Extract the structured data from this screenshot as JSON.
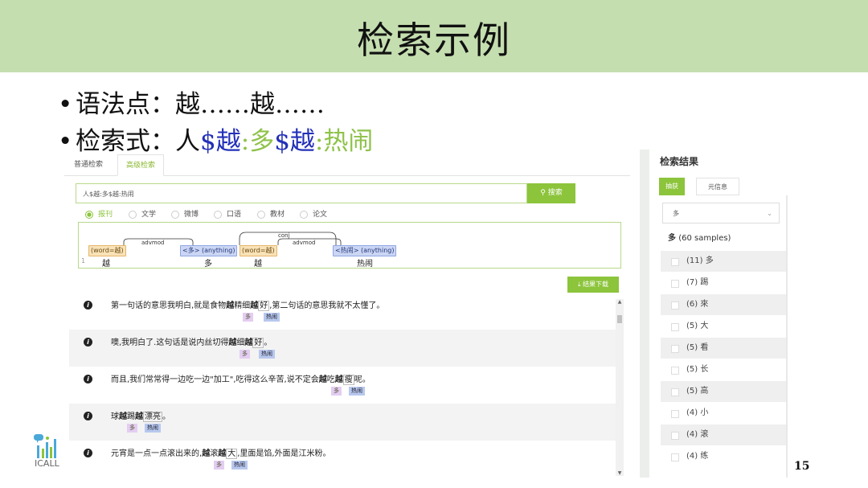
{
  "slide": {
    "title": "检索示例",
    "bullet1_label": "语法点：",
    "bullet1_value": "越……越……",
    "bullet2_label": "检索式：",
    "bullet2_parts": [
      "人",
      "$越",
      ":",
      "多",
      "$越",
      ":",
      "热闹"
    ],
    "page_number": "15",
    "logo_text": "ICALL"
  },
  "app": {
    "tabs": [
      "普通检索",
      "高级检索"
    ],
    "active_tab": "高级检索",
    "search_value": "人$越:多$越:热闹",
    "search_button": "搜索",
    "radios": [
      "报刊",
      "文学",
      "微博",
      "口语",
      "教材",
      "论文"
    ],
    "radio_selected": "报刊",
    "download_button": "结果下载"
  },
  "parse": {
    "line_number": "1",
    "nodes": [
      "(word=越)",
      "<多> (anything)",
      "(word=越)",
      "<热闹> (anything)"
    ],
    "tokens": [
      "越",
      "多",
      "越",
      "热闹"
    ],
    "arcs": [
      "advmod",
      "conj",
      "advmod"
    ]
  },
  "results": [
    {
      "pre": "第一句话的意思我明白,就是食物",
      "b1": "越",
      "mid1": "精细",
      "b2": "越",
      "box": "好",
      "post": ",第二句话的意思我就不太懂了。",
      "tag1": "多",
      "tag2": "热闹"
    },
    {
      "pre": "噢,我明白了.这句话是说内丝切得",
      "b1": "越",
      "mid1": "细",
      "b2": "越",
      "box": "好",
      "post": "。",
      "tag1": "多",
      "tag2": "热闹"
    },
    {
      "pre": "而且,我们常常得一边吃一边\"加工\",吃得这么辛苦,说不定会",
      "b1": "越",
      "mid1": "吃",
      "b2": "越",
      "box": "瘦",
      "post": "呢。",
      "tag1": "多",
      "tag2": "热闹"
    },
    {
      "pre": "球",
      "b1": "越",
      "mid1": "踢",
      "b2": "越",
      "box": "漂亮",
      "post": "。",
      "tag1": "多",
      "tag2": "热闹"
    },
    {
      "pre": "元宵是一点一点滚出来的,",
      "b1": "越",
      "mid1": "滚",
      "b2": "越",
      "box": "大",
      "post": ",里面是馅,外面是江米粉。",
      "tag1": "多",
      "tag2": "热闹"
    }
  ],
  "right_panel": {
    "title": "检索结果",
    "tab_active": "抽获",
    "tab_other": "元信息",
    "select_value": "多",
    "head_word": "多",
    "head_count": "(60 samples)",
    "items": [
      "(11) 多",
      "(7) 踢",
      "(6) 來",
      "(5) 大",
      "(5) 看",
      "(5) 长",
      "(5) 高",
      "(4) 小",
      "(4) 滚",
      "(4) 练"
    ]
  },
  "colors": {
    "title_bar": "#c5deb0",
    "accent_green": "#8cc43c",
    "query_blue": "#2330b8",
    "query_green": "#8fc24a"
  }
}
